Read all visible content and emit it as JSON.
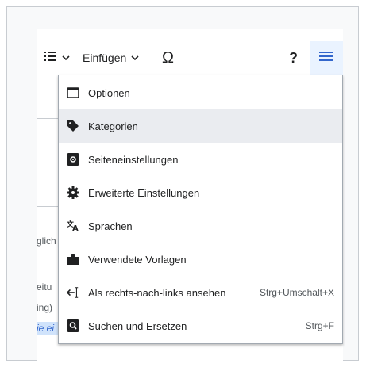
{
  "toolbar": {
    "insert_label": "Einfügen",
    "special_char": "Ω",
    "help": "?"
  },
  "background_text": {
    "line1": "glich",
    "line2": "eitu",
    "line3": "ing)",
    "line4": "ie ei"
  },
  "menu": {
    "items": [
      {
        "label": "Optionen",
        "shortcut": "",
        "icon": "window-icon"
      },
      {
        "label": "Kategorien",
        "shortcut": "",
        "icon": "tag-icon"
      },
      {
        "label": "Seiteneinstellungen",
        "shortcut": "",
        "icon": "page-settings-icon"
      },
      {
        "label": "Erweiterte Einstellungen",
        "shortcut": "",
        "icon": "gear-icon"
      },
      {
        "label": "Sprachen",
        "shortcut": "",
        "icon": "language-icon"
      },
      {
        "label": "Verwendete Vorlagen",
        "shortcut": "",
        "icon": "puzzle-icon"
      },
      {
        "label": "Als rechts-nach-links ansehen",
        "shortcut": "Strg+Umschalt+X",
        "icon": "text-direction-icon"
      },
      {
        "label": "Suchen und Ersetzen",
        "shortcut": "Strg+F",
        "icon": "find-replace-icon"
      }
    ]
  },
  "colors": {
    "accent": "#3366cc",
    "highlight": "#eaecf0",
    "menu_button_bg": "#eaf3ff"
  }
}
